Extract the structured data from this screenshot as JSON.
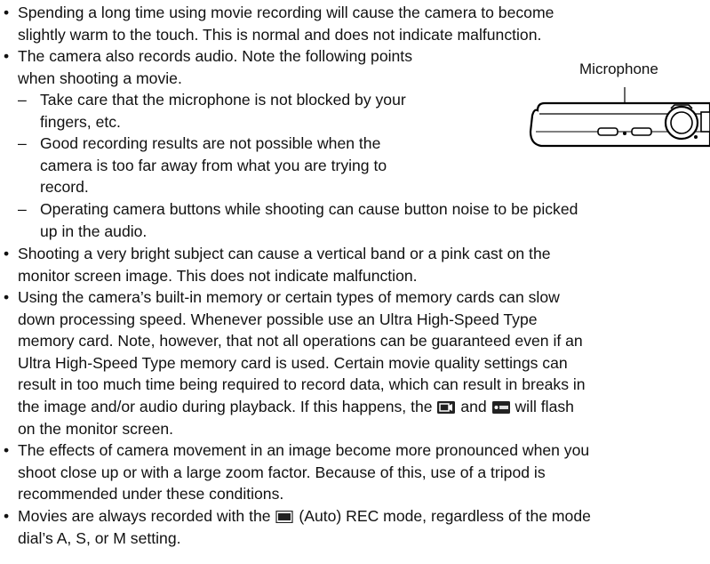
{
  "bullets": [
    {
      "lines": [
        "Spending a long time using movie recording will cause the camera to become",
        "slightly warm to the touch. This is normal and does not indicate malfunction."
      ]
    },
    {
      "lines": [
        "The camera also records audio. Note the following points",
        "when shooting a movie."
      ],
      "sub": [
        {
          "lines": [
            "Take care that the microphone is not blocked by your",
            "fingers, etc."
          ]
        },
        {
          "lines": [
            "Good recording results are not possible when the",
            "camera is too far away from what you are trying to",
            "record."
          ]
        },
        {
          "lines": [
            "Operating camera buttons while shooting can cause button noise to be picked",
            "up in the audio."
          ]
        }
      ]
    },
    {
      "lines": [
        "Shooting a very bright subject can cause a vertical band or a pink cast on the",
        "monitor screen image. This does not indicate malfunction."
      ]
    },
    {
      "lines": [
        "Using the camera’s built-in memory or certain types of memory cards can slow",
        "down processing speed. Whenever possible use an Ultra High-Speed Type",
        "memory card. Note, however, that not all operations can be guaranteed even if an",
        "Ultra High-Speed Type memory card is used. Certain movie quality settings can",
        "result in too much time being required to record data, which can result in breaks in"
      ],
      "line6_a": "the image and/or audio during playback. If this happens, the",
      "line6_b": "and",
      "line6_c": "will flash",
      "line7": "on the monitor screen."
    },
    {
      "lines": [
        "The effects of camera movement in an image become more pronounced when you",
        "shoot close up or with a large zoom factor. Because of this, use of a tripod is",
        "recommended under these conditions."
      ]
    },
    {
      "line1_a": "Movies are always recorded with the",
      "line1_b": "(Auto) REC mode, regardless of the mode",
      "line2": "dial’s A, S, or M setting."
    }
  ],
  "bullet_symbol": "•",
  "dash_symbol": "–",
  "figure": {
    "label": "Microphone"
  },
  "icons": {
    "buffer": "movie-buffer-icon",
    "rec": "rec-indicator-icon",
    "auto": "auto-mode-icon"
  }
}
